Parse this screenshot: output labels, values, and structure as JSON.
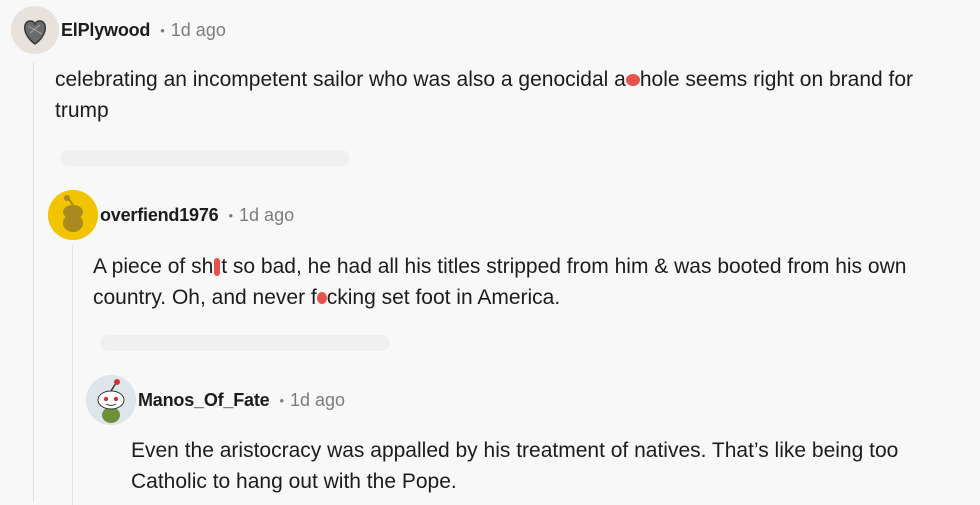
{
  "comments": [
    {
      "username": "ElPlywood",
      "separator": "•",
      "time": "1d ago",
      "text_before": "celebrating an incompetent sailor who was also a genocidal a",
      "text_after": "hole seems right on brand for trump",
      "avatar_color": "#e7e2db"
    },
    {
      "username": "overfiend1976",
      "separator": "•",
      "time": "1d ago",
      "text_part1": "A piece of sh",
      "text_part2": "t so bad, he had all his titles stripped from him & was booted from his own country.  Oh, and never f",
      "text_part3": "cking set foot in America.",
      "avatar_color": "#f2c400"
    },
    {
      "username": "Manos_Of_Fate",
      "separator": "•",
      "time": "1d ago",
      "text": "Even the aristocracy was appalled by his treatment of natives. That’s like being too Catholic to hang out with the Pope.",
      "avatar_color": "#dfe6ea"
    }
  ],
  "colors": {
    "censor": "#e8524e",
    "meta": "#7c7c7c",
    "text": "#1c1c1c",
    "background": "#f8f8f8"
  }
}
